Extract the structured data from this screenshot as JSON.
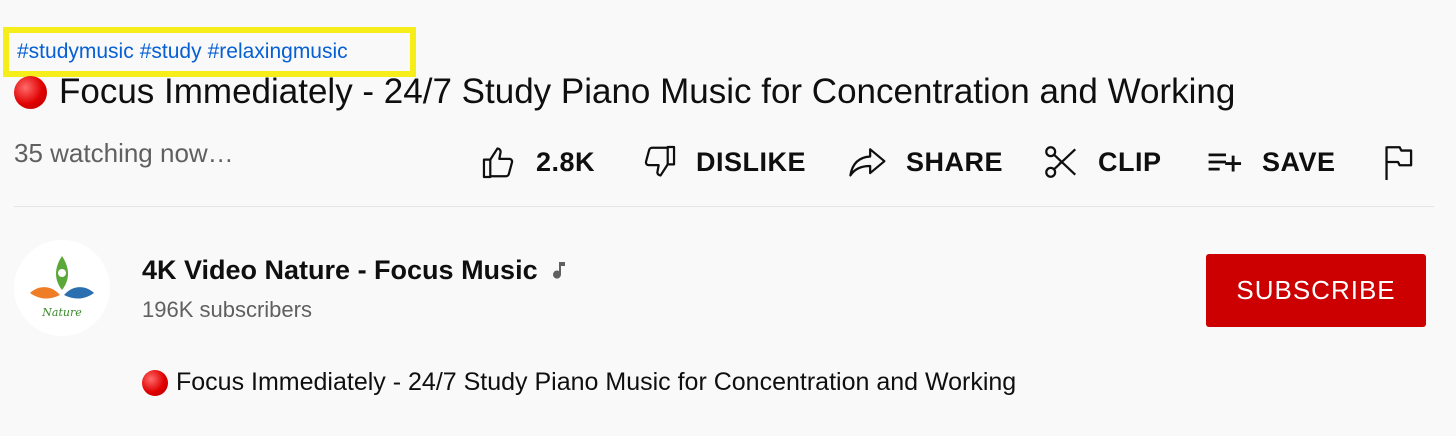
{
  "hashtags": [
    "#studymusic",
    "#study",
    "#relaxingmusic"
  ],
  "video": {
    "title": "Focus Immediately - 24/7 Study Piano Music for Concentration and Working",
    "watching": "35 watching now…"
  },
  "actions": {
    "like_count": "2.8K",
    "dislike_label": "DISLIKE",
    "share_label": "SHARE",
    "clip_label": "CLIP",
    "save_label": "SAVE"
  },
  "channel": {
    "name": "4K Video Nature - Focus Music",
    "subscribers": "196K subscribers",
    "subscribe_label": "SUBSCRIBE",
    "logo_text": "Nature"
  },
  "description": {
    "text": "Focus Immediately - 24/7 Study Piano Music for Concentration and Working"
  },
  "colors": {
    "hashtag": "#065fd4",
    "highlight_border": "#f5ee1b",
    "subscribe_bg": "#cc0000",
    "live_dot": "#e00000"
  },
  "icons": [
    "live-dot-icon",
    "thumbs-up-icon",
    "thumbs-down-icon",
    "share-arrow-icon",
    "scissors-icon",
    "playlist-add-icon",
    "flag-icon",
    "music-note-icon"
  ]
}
